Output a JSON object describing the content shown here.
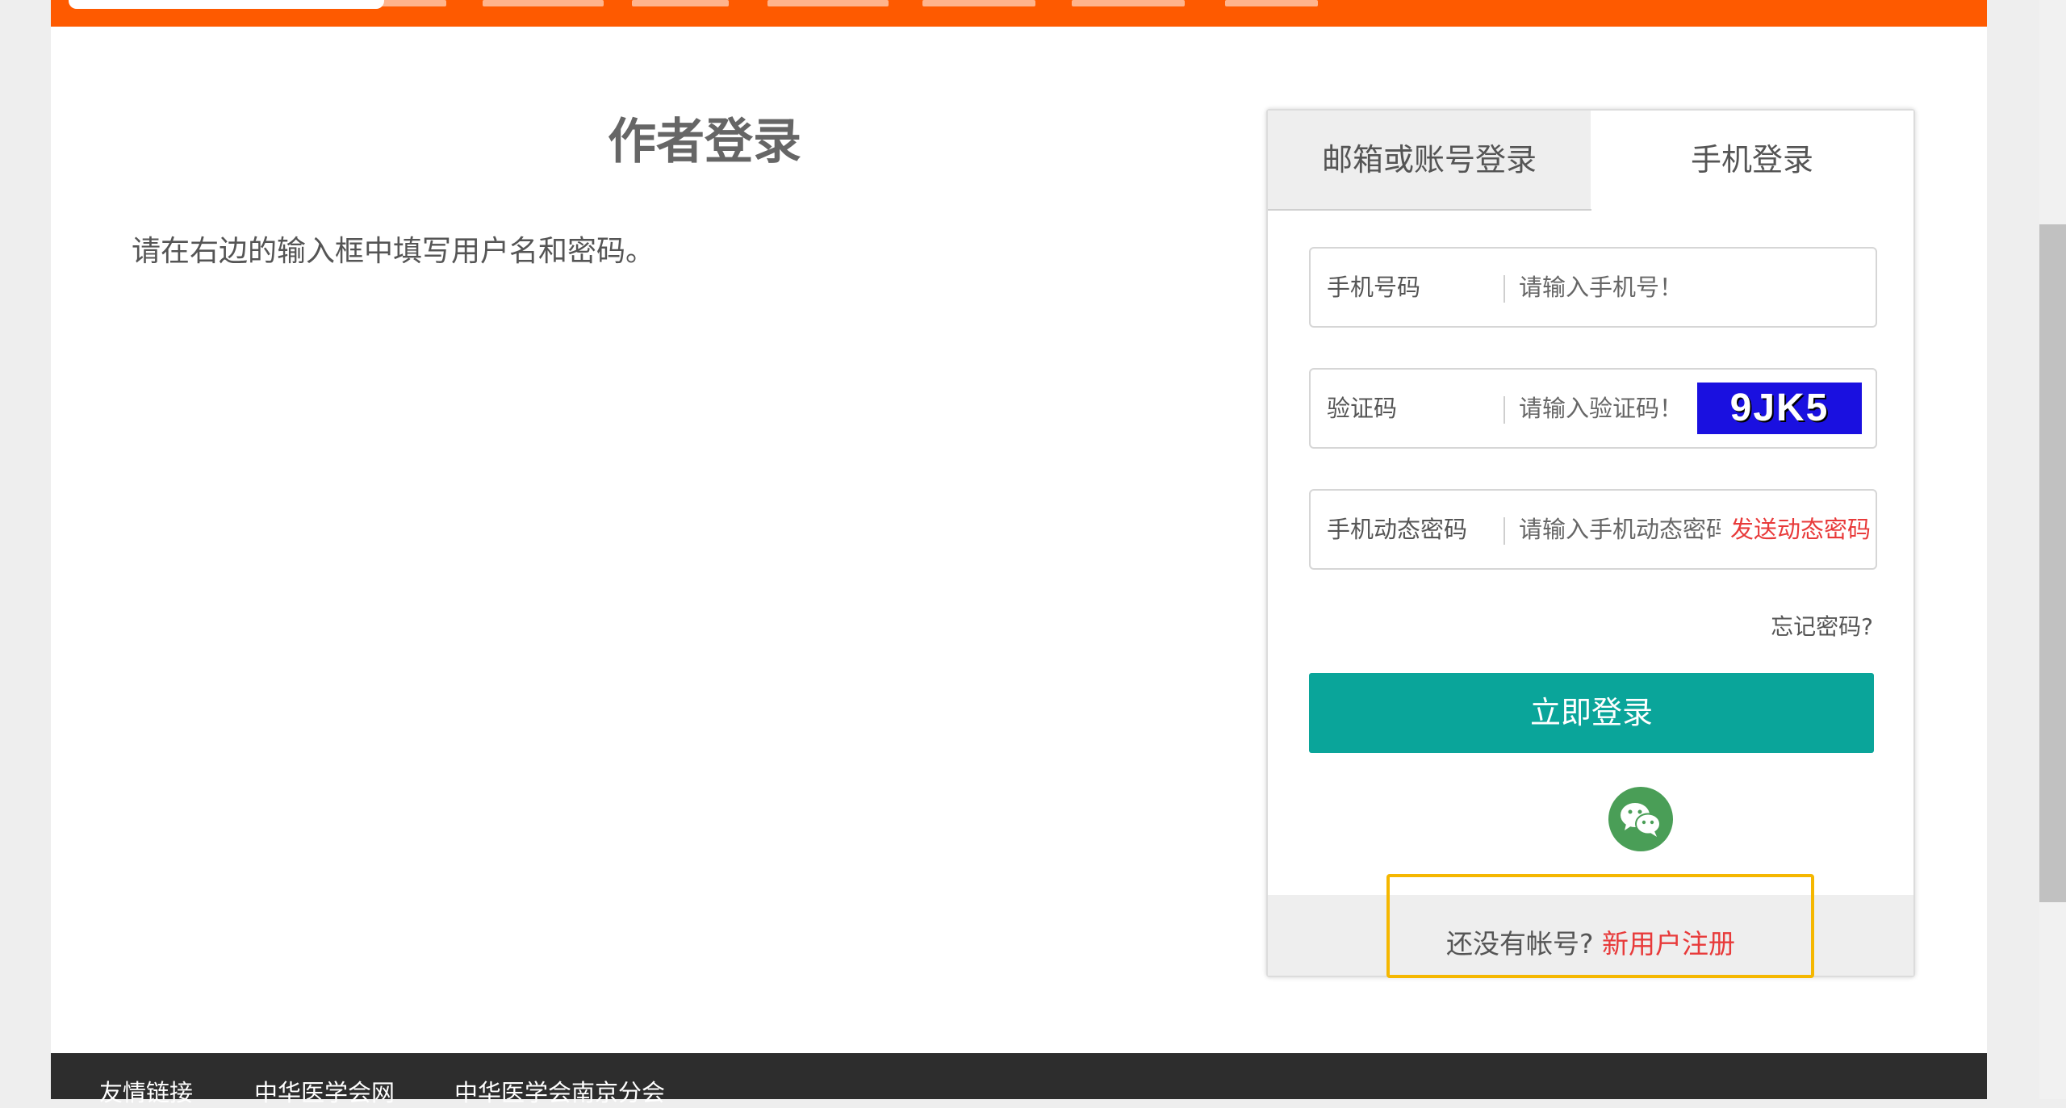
{
  "page": {
    "title": "作者登录",
    "hint": "请在右边的输入框中填写用户名和密码。"
  },
  "tabs": {
    "email": "邮箱或账号登录",
    "phone": "手机登录"
  },
  "form": {
    "phone_label": "手机号码",
    "phone_placeholder": "请输入手机号！",
    "captcha_label": "验证码",
    "captcha_placeholder": "请输入验证码！",
    "captcha_image_text": "9JK5",
    "sms_label": "手机动态密码",
    "sms_placeholder": "请输入手机动态密码",
    "send_code": "发送动态密码",
    "forgot": "忘记密码?",
    "login_button": "立即登录",
    "register_prompt": "还没有帐号?",
    "register_link": "新用户注册"
  },
  "footer": {
    "links_heading": "友情链接",
    "link1": "中华医学会网",
    "link2": "中华医学会南京分会"
  },
  "colors": {
    "nav": "#fe5a00",
    "primary_button": "#0aa59a",
    "link_red": "#e83a3a",
    "highlight": "#f5b700"
  }
}
